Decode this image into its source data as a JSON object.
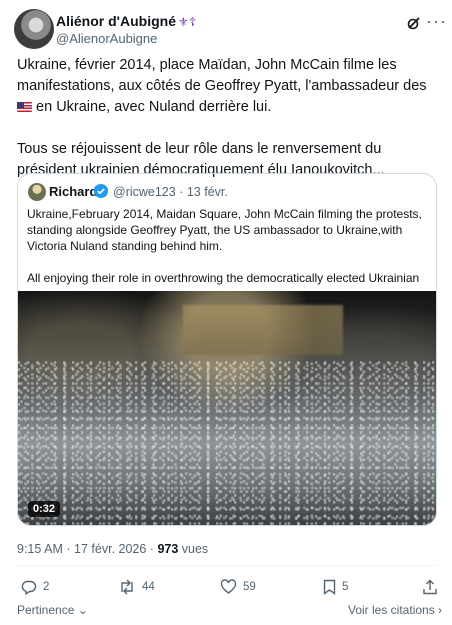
{
  "author": {
    "name": "Aliénor d'Aubigné",
    "name_emoji": "⚜☦",
    "handle": "@AlienorAubigne"
  },
  "tweet": {
    "paragraph1_before_flag": "Ukraine, février 2014, place Maïdan, John McCain filme les manifestations, aux côtés de Geoffrey Pyatt, l'ambassadeur des",
    "paragraph1_after_flag": "en Ukraine, avec Nuland derrière lui.",
    "paragraph2": "Tous se réjouissent de leur rôle dans le renversement du président ukrainien démocratiquement élu Ianoukovitch..."
  },
  "quoted": {
    "name": "Richard",
    "handle": "@ricwe123",
    "separator": "·",
    "date": "13 févr.",
    "paragraph1": "Ukraine,February 2014, Maidan Square, John McCain filming the protests, standing alongside Geoffrey Pyatt, the US ambassador to Ukraine,with Victoria Nuland standing behind him.",
    "paragraph2": "All enjoying their role in overthrowing the democratically elected Ukrainian ...",
    "video_duration": "0:32"
  },
  "meta": {
    "time": "9:15 AM",
    "separator": "·",
    "date": "17 févr. 2026",
    "views_count": "973",
    "views_label": "vues"
  },
  "actions": {
    "replies": "2",
    "reposts": "44",
    "likes": "59",
    "bookmarks": "5"
  },
  "footer": {
    "relevance_label": "Pertinence",
    "quotes_link": "Voir les citations"
  },
  "colors": {
    "text": "#0f1419",
    "secondary": "#536471",
    "verified": "#1d9bf0",
    "border": "#cfd9de"
  }
}
